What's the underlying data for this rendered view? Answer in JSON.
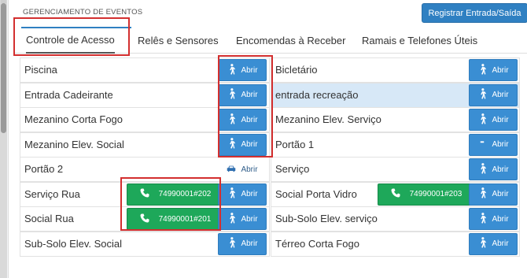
{
  "header": {
    "title": "GERENCIAMENTO DE EVENTOS",
    "register_button": "Registrar Entrada/Saída"
  },
  "tabs": [
    {
      "label": "Controle de Acesso",
      "active": true
    },
    {
      "label": "Relês e Sensores",
      "active": false
    },
    {
      "label": "Encomendas à Receber",
      "active": false
    },
    {
      "label": "Ramais e Telefones Úteis",
      "active": false
    }
  ],
  "left_rows": [
    {
      "label": "Piscina",
      "button": "Abrir",
      "icon": "walking-person-icon"
    },
    {
      "label": "Entrada Cadeirante",
      "button": "Abrir",
      "icon": "walking-person-icon"
    },
    {
      "label": "Mezanino Corta Fogo",
      "button": "Abrir",
      "icon": "walking-person-icon"
    },
    {
      "label": "Mezanino Elev. Social",
      "button": "Abrir",
      "icon": "walking-person-icon"
    },
    {
      "label": "Portão 2",
      "button": "Abrir",
      "icon": "car-icon"
    },
    {
      "label": "Serviço Rua",
      "button": "Abrir",
      "icon": "walking-person-icon",
      "phone": "74990001#202"
    },
    {
      "label": "Social Rua",
      "button": "Abrir",
      "icon": "walking-person-icon",
      "phone": "74990001#201"
    },
    {
      "label": "Sub-Solo Elev. Social",
      "button": "Abrir",
      "icon": "walking-person-icon"
    }
  ],
  "right_rows": [
    {
      "label": "Bicletário",
      "button": "Abrir",
      "icon": "walking-person-icon"
    },
    {
      "label": "entrada recreação",
      "button": "Abrir",
      "icon": "walking-person-icon"
    },
    {
      "label": "Mezanino Elev. Serviço",
      "button": "Abrir",
      "icon": "walking-person-icon"
    },
    {
      "label": "Portão 1",
      "button": "Abrir",
      "icon": "car-icon"
    },
    {
      "label": "Serviço",
      "button": "Abrir",
      "icon": "walking-person-icon"
    },
    {
      "label": "Social Porta Vidro",
      "button": "Abrir",
      "icon": "walking-person-icon",
      "phone": "74990001#203"
    },
    {
      "label": "Sub-Solo Elev. serviço",
      "button": "Abrir",
      "icon": "walking-person-icon"
    },
    {
      "label": "Térreo Corta Fogo",
      "button": "Abrir",
      "icon": "walking-person-icon"
    }
  ],
  "colors": {
    "primary": "#3a8ed3",
    "success": "#1ea85a",
    "highlight_row": "#d7e8f7",
    "annotation_red": "#d32f2f"
  }
}
